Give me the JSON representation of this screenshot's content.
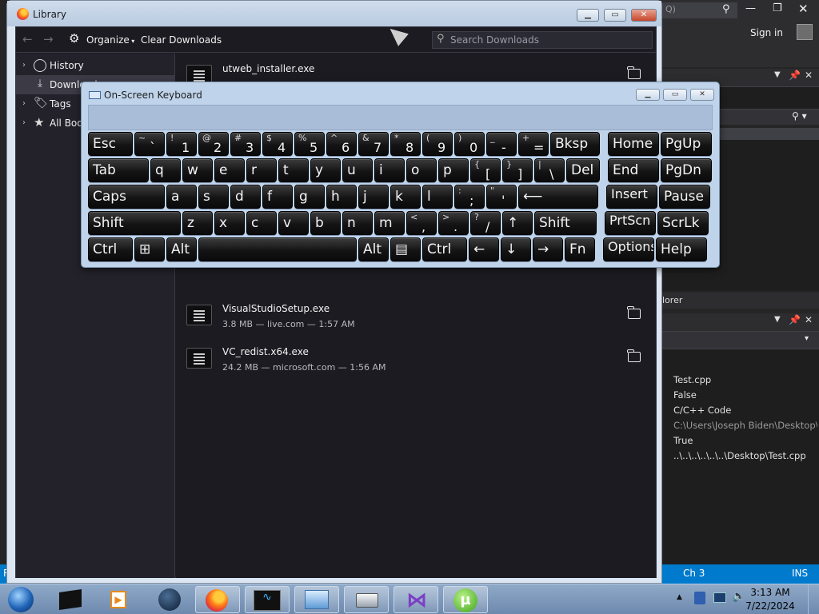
{
  "vs": {
    "search_hint": "Q)",
    "sign_in": "Sign in",
    "panel_fragment": "lorer",
    "properties": [
      "Test.cpp",
      "False",
      "C/C++ Code",
      "C:\\Users\\Joseph Biden\\Desktop\\T",
      "True",
      "..\\..\\..\\..\\..\\..\\Desktop\\Test.cpp"
    ],
    "status_left": "R",
    "status_col": "Ch 3",
    "status_mode": "INS"
  },
  "library": {
    "title": "Library",
    "toolbar": {
      "organize_label": "Organize",
      "clear_label": "Clear Downloads",
      "search_placeholder": "Search Downloads"
    },
    "sidebar": [
      {
        "label": "History",
        "icon": "clock-icon"
      },
      {
        "label": "Downloads",
        "icon": "download-icon"
      },
      {
        "label": "Tags",
        "icon": "tag-icon"
      },
      {
        "label": "All Bookmarks",
        "icon": "star-icon"
      }
    ],
    "downloads": [
      {
        "name": "utweb_installer.exe",
        "meta": ""
      },
      {
        "name": "VisualStudioSetup.exe",
        "meta": "3.8 MB — live.com — 1:57 AM"
      },
      {
        "name": "VC_redist.x64.exe",
        "meta": "24.2 MB — microsoft.com — 1:56 AM"
      }
    ]
  },
  "osk": {
    "title": "On-Screen Keyboard",
    "rows": [
      [
        {
          "l": "Esc"
        },
        {
          "s": "~",
          "m": "`"
        },
        {
          "s": "!",
          "m": "1"
        },
        {
          "s": "@",
          "m": "2"
        },
        {
          "s": "#",
          "m": "3"
        },
        {
          "s": "$",
          "m": "4"
        },
        {
          "s": "%",
          "m": "5"
        },
        {
          "s": "^",
          "m": "6"
        },
        {
          "s": "&",
          "m": "7"
        },
        {
          "s": "*",
          "m": "8"
        },
        {
          "s": "(",
          "m": "9"
        },
        {
          "s": ")",
          "m": "0"
        },
        {
          "s": "_",
          "m": "-"
        },
        {
          "s": "+",
          "m": "="
        },
        {
          "l": "Bksp"
        },
        {
          "l": "Home"
        },
        {
          "l": "PgUp"
        }
      ],
      [
        {
          "l": "Tab"
        },
        {
          "l": "q"
        },
        {
          "l": "w"
        },
        {
          "l": "e"
        },
        {
          "l": "r"
        },
        {
          "l": "t"
        },
        {
          "l": "y"
        },
        {
          "l": "u"
        },
        {
          "l": "i"
        },
        {
          "l": "o"
        },
        {
          "l": "p"
        },
        {
          "s": "{",
          "m": "["
        },
        {
          "s": "}",
          "m": "]"
        },
        {
          "s": "|",
          "m": "\\"
        },
        {
          "l": "Del"
        },
        {
          "l": "End"
        },
        {
          "l": "PgDn"
        }
      ],
      [
        {
          "l": "Caps"
        },
        {
          "l": "a"
        },
        {
          "l": "s"
        },
        {
          "l": "d"
        },
        {
          "l": "f"
        },
        {
          "l": "g"
        },
        {
          "l": "h"
        },
        {
          "l": "j"
        },
        {
          "l": "k"
        },
        {
          "l": "l"
        },
        {
          "s": ":",
          "m": ";"
        },
        {
          "s": "\"",
          "m": "'"
        },
        {
          "l": "⟵"
        },
        {
          "l": "Insert"
        },
        {
          "l": "Pause"
        }
      ],
      [
        {
          "l": "Shift"
        },
        {
          "l": "z"
        },
        {
          "l": "x"
        },
        {
          "l": "c"
        },
        {
          "l": "v"
        },
        {
          "l": "b"
        },
        {
          "l": "n"
        },
        {
          "l": "m"
        },
        {
          "s": "<",
          "m": ","
        },
        {
          "s": ">",
          "m": "."
        },
        {
          "s": "?",
          "m": "/"
        },
        {
          "l": "↑"
        },
        {
          "l": "Shift"
        },
        {
          "l": "PrtScn"
        },
        {
          "l": "ScrLk"
        }
      ],
      [
        {
          "l": "Ctrl"
        },
        {
          "l": "⊞"
        },
        {
          "l": "Alt"
        },
        {
          "l": ""
        },
        {
          "l": "Alt"
        },
        {
          "l": "▤"
        },
        {
          "l": "Ctrl"
        },
        {
          "l": "←"
        },
        {
          "l": "↓"
        },
        {
          "l": "→"
        },
        {
          "l": "Fn"
        },
        {
          "l": "Options"
        },
        {
          "l": "Help"
        }
      ]
    ]
  },
  "taskbar": {
    "icons": [
      "start-orb",
      "app-black-icon",
      "media-player-icon",
      "globe-icon",
      "firefox-icon",
      "monitor-app-icon",
      "remote-desktop-icon",
      "printer-icon",
      "visual-studio-icon",
      "utorrent-icon"
    ],
    "time": "3:13 AM",
    "date": "7/22/2024"
  },
  "colors": {
    "vs_blue": "#007acc",
    "osk_blue": "#bfd3ea",
    "library_bg": "#1c1b22"
  }
}
